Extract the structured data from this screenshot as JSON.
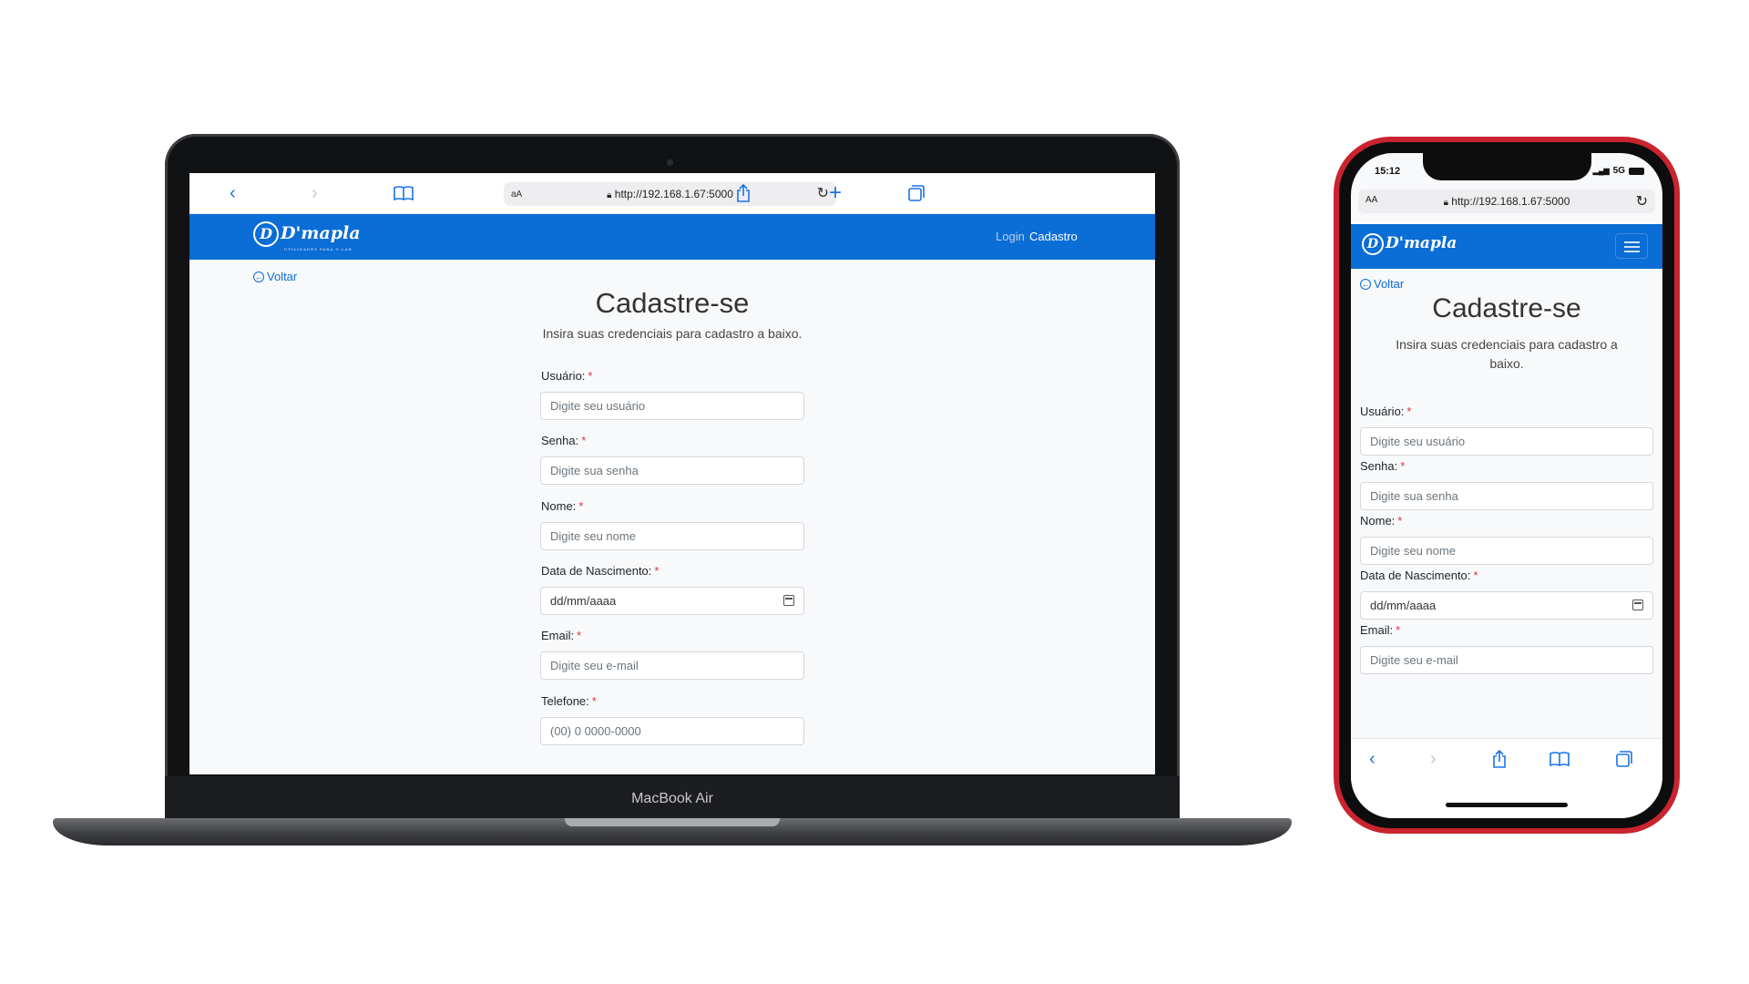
{
  "browser": {
    "url": "http://192.168.1.67:5000",
    "text_size_label": "AA",
    "icons": [
      "back-icon",
      "forward-icon",
      "bookmarks-icon",
      "lock-icon",
      "reload-icon",
      "share-icon",
      "new-tab-icon",
      "tabs-icon"
    ]
  },
  "site": {
    "logo": "D'mapla",
    "logo_tagline": "UTILIDADES PARA O LAR",
    "nav": {
      "login": "Login",
      "cadastro": "Cadastro"
    },
    "back": "Voltar",
    "title": "Cadastre-se",
    "subtitle": "Insira suas credenciais para cadastro a baixo.",
    "required_mark": "*",
    "fields": [
      {
        "label": "Usuário:",
        "placeholder": "Digite seu usuário"
      },
      {
        "label": "Senha:",
        "placeholder": "Digite sua senha"
      },
      {
        "label": "Nome:",
        "placeholder": "Digite seu nome"
      },
      {
        "label": "Data de Nascimento:",
        "placeholder": "dd/mm/aaaa"
      },
      {
        "label": "Email:",
        "placeholder": "Digite seu e-mail"
      },
      {
        "label": "Telefone:",
        "placeholder": "(00) 0 0000-0000"
      }
    ]
  },
  "laptop": {
    "brand": "MacBook Air"
  },
  "phone": {
    "time": "15:12",
    "network": "5G",
    "subtitle_line1": "Insira suas credenciais para cadastro a",
    "subtitle_line2": "baixo."
  },
  "colors": {
    "primary": "#0b6dd6",
    "required": "#dc3545",
    "phone_frame": "#c9242f"
  }
}
